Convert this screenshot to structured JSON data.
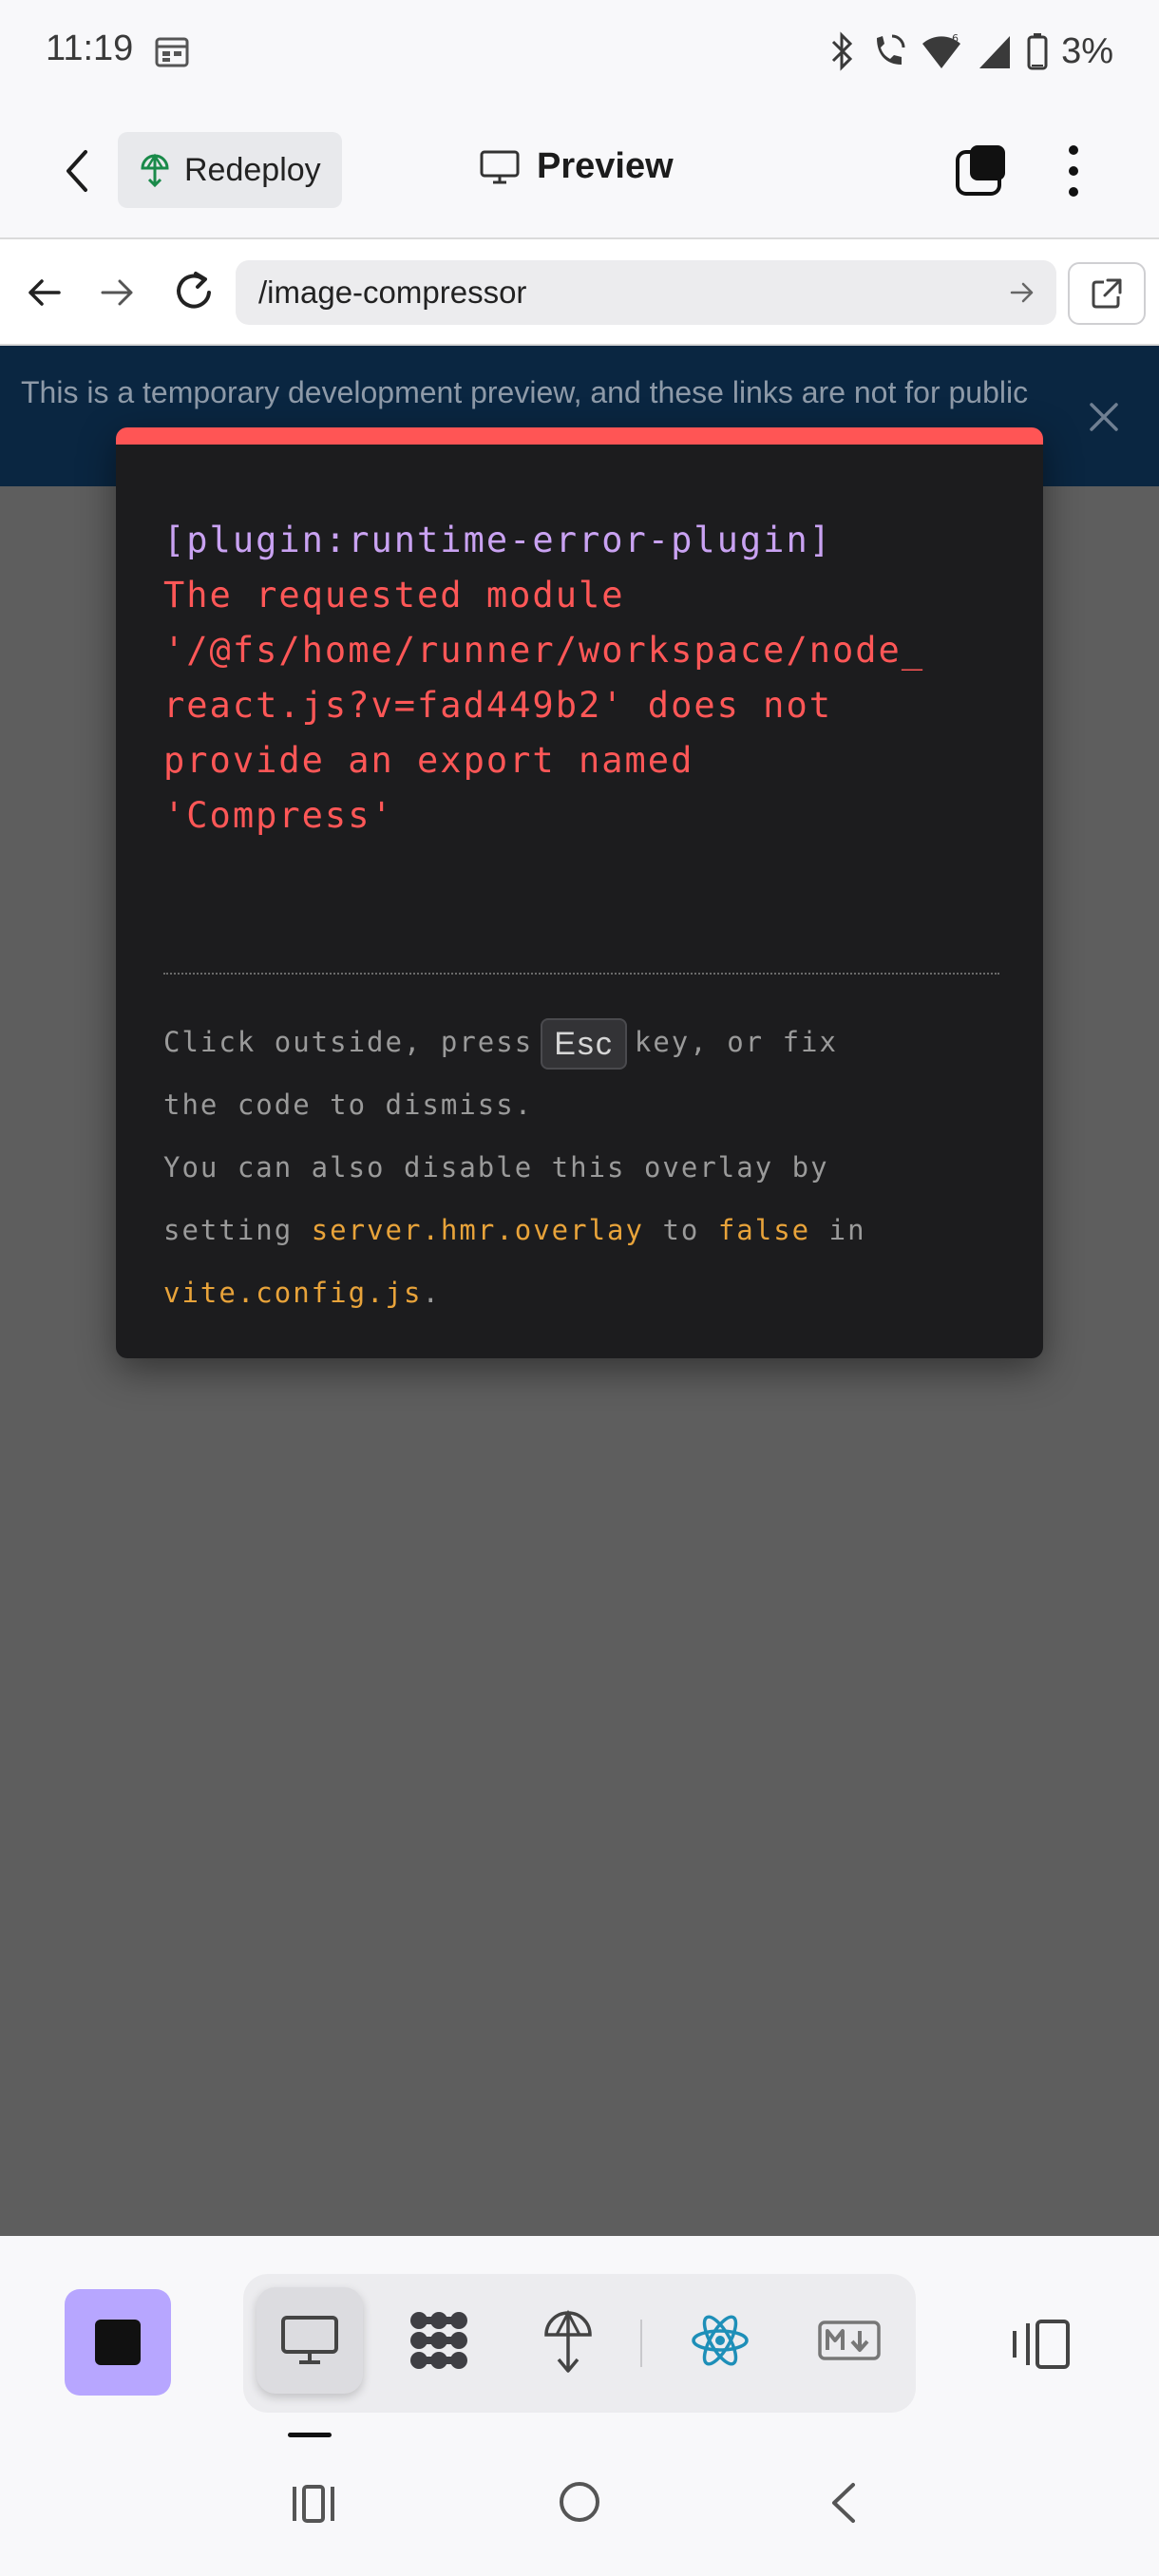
{
  "status_bar": {
    "time": "11:19",
    "battery": "3%"
  },
  "header": {
    "redeploy_label": "Redeploy",
    "title": "Preview"
  },
  "url_bar": {
    "url": "/image-compressor"
  },
  "banner": {
    "text": "This is a temporary development preview, and these links are not for public"
  },
  "error_overlay": {
    "plugin": "[plugin:runtime-error-plugin]",
    "message_lines": [
      "The requested module",
      "'/@fs/home/runner/workspace/node_",
      "react.js?v=fad449b2' does not",
      "provide an export named",
      "'Compress'"
    ],
    "tip_part1": "Click outside, press",
    "esc_key": "Esc",
    "tip_part2": "key, or fix",
    "tip_part3": "the code to dismiss.",
    "tip_part4": "You can also disable this overlay by",
    "tip_part5": "setting",
    "code1": "server.hmr.overlay",
    "tip_part6": "to",
    "code2": "false",
    "tip_part7": "in",
    "code3": "vite.config.js",
    "tip_part8": "."
  },
  "colors": {
    "accent_purple": "#b7a6ff",
    "error_red": "#ff5757",
    "banner_bg": "#0a2641",
    "code_orange": "#e8a33a",
    "react_blue": "#1e8fb8"
  },
  "icons": {
    "tools": [
      "monitor-icon",
      "workflow-icon",
      "deploy-icon",
      "react-icon",
      "markdown-icon"
    ]
  }
}
